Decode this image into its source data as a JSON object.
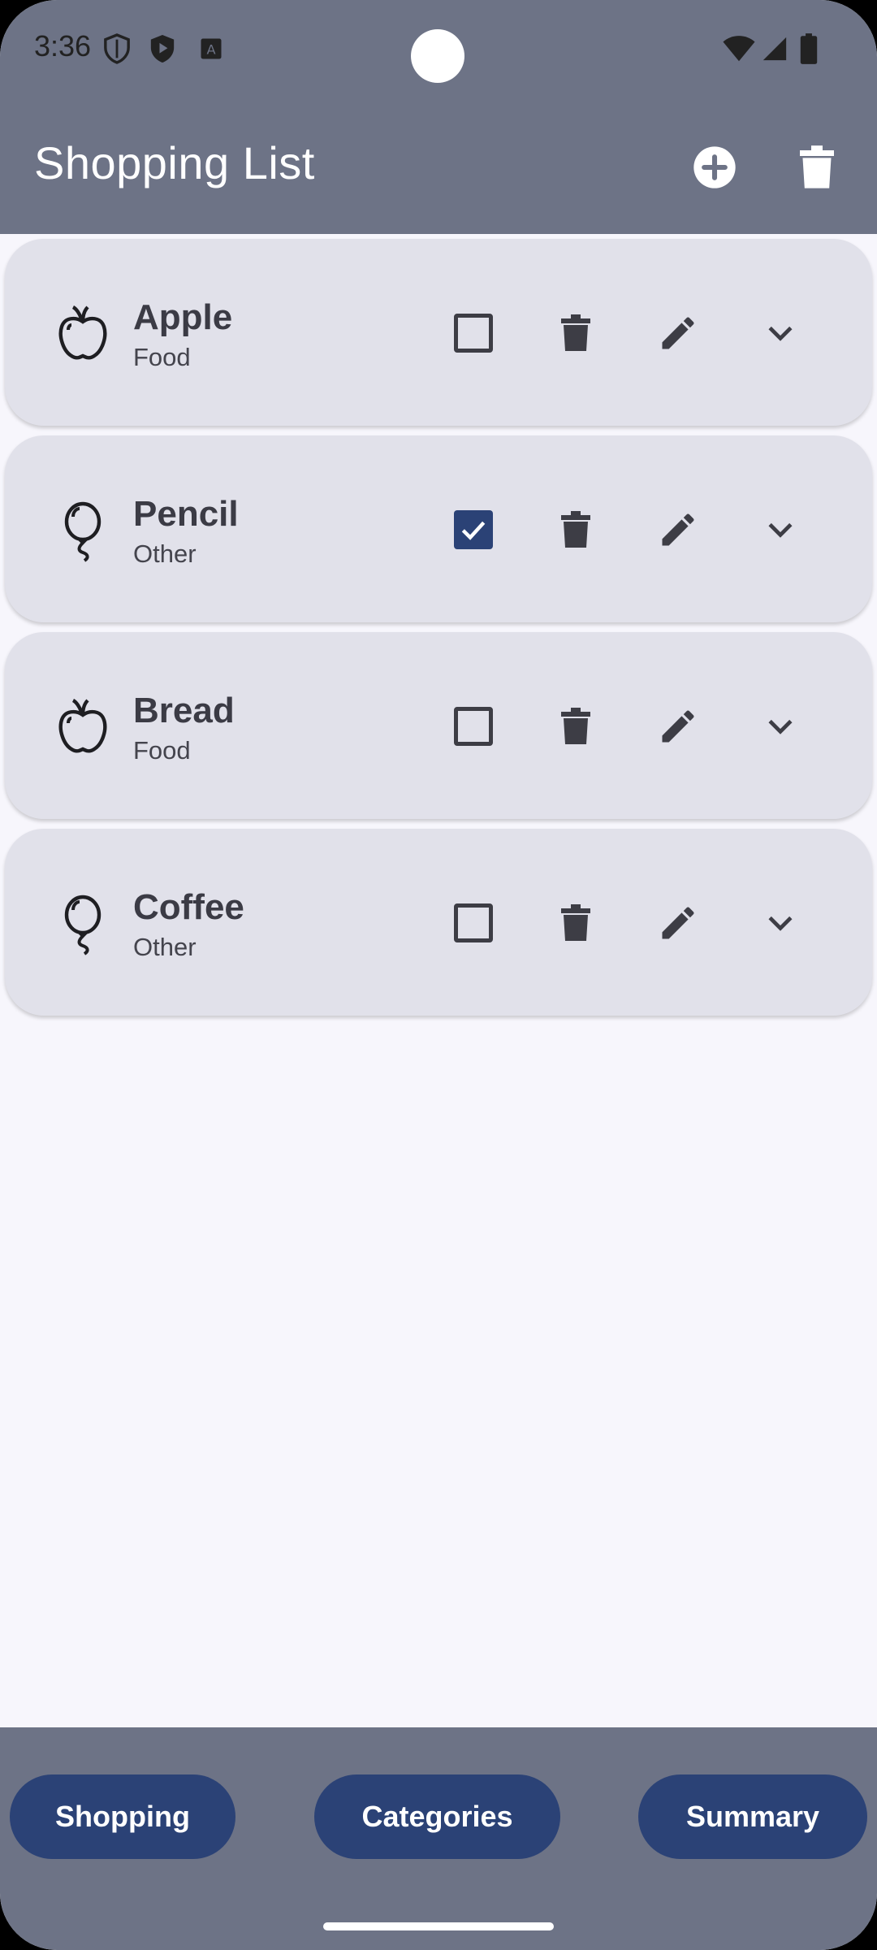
{
  "status_bar": {
    "time": "3:36",
    "left_icons": [
      "shield-icon",
      "play-shield-icon",
      "font-a-icon"
    ],
    "right_icons": [
      "wifi-icon",
      "signal-icon",
      "battery-icon"
    ]
  },
  "app_bar": {
    "title": "Shopping List",
    "actions": [
      "add-circle-icon",
      "delete-icon"
    ]
  },
  "items": [
    {
      "name": "Apple",
      "category": "Food",
      "icon": "apple-icon",
      "checked": false
    },
    {
      "name": "Pencil",
      "category": "Other",
      "icon": "balloon-icon",
      "checked": true
    },
    {
      "name": "Bread",
      "category": "Food",
      "icon": "apple-icon",
      "checked": false
    },
    {
      "name": "Coffee",
      "category": "Other",
      "icon": "balloon-icon",
      "checked": false
    }
  ],
  "bottom_nav": {
    "shopping_label": "Shopping",
    "categories_label": "Categories",
    "summary_label": "Summary"
  },
  "colors": {
    "bar_background": "#6d7386",
    "accent": "#2b4276",
    "card_background": "#e1e1ea",
    "page_background": "#f7f6fc"
  }
}
